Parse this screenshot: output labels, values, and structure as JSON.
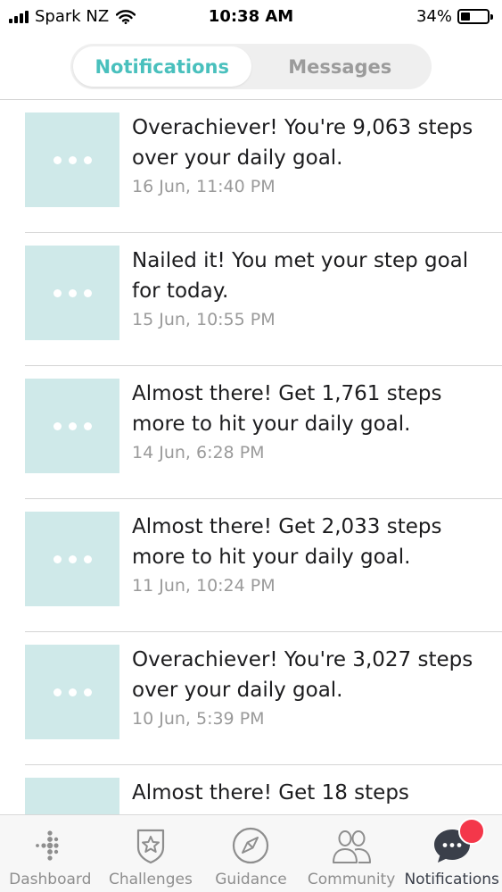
{
  "status_bar": {
    "carrier": "Spark NZ",
    "time": "10:38 AM",
    "battery_percent": "34%",
    "battery_level": 0.34,
    "signal_icon": "signal-bars-icon",
    "wifi_icon": "wifi-icon",
    "battery_icon": "battery-icon"
  },
  "segmented": {
    "tabs": [
      {
        "label": "Notifications",
        "active": true
      },
      {
        "label": "Messages",
        "active": false
      }
    ]
  },
  "colors": {
    "accent": "#49c0bd",
    "thumb_bg": "#cfe9e9",
    "badge": "#f4374a",
    "timestamp": "#9a9a9a"
  },
  "notifications": [
    {
      "title": "Overachiever! You're 9,063 steps over your daily goal.",
      "time": "16 Jun, 11:40 PM"
    },
    {
      "title": "Nailed it! You met your step goal for today.",
      "time": "15 Jun, 10:55 PM"
    },
    {
      "title": "Almost there! Get 1,761 steps more to hit your daily goal.",
      "time": "14 Jun, 6:28 PM"
    },
    {
      "title": "Almost there! Get 2,033 steps more to hit your daily goal.",
      "time": "11 Jun, 10:24 PM"
    },
    {
      "title": "Overachiever! You're 3,027 steps over your daily goal.",
      "time": "10 Jun, 5:39 PM"
    },
    {
      "title": "Almost there! Get 18 steps",
      "time": ""
    }
  ],
  "tab_bar": {
    "items": [
      {
        "label": "Dashboard",
        "icon": "dashboard-dots-icon",
        "active": false
      },
      {
        "label": "Challenges",
        "icon": "challenges-badge-icon",
        "active": false
      },
      {
        "label": "Guidance",
        "icon": "compass-icon",
        "active": false
      },
      {
        "label": "Community",
        "icon": "community-people-icon",
        "active": false
      },
      {
        "label": "Notifications",
        "icon": "chat-bubble-icon",
        "active": true
      }
    ]
  }
}
